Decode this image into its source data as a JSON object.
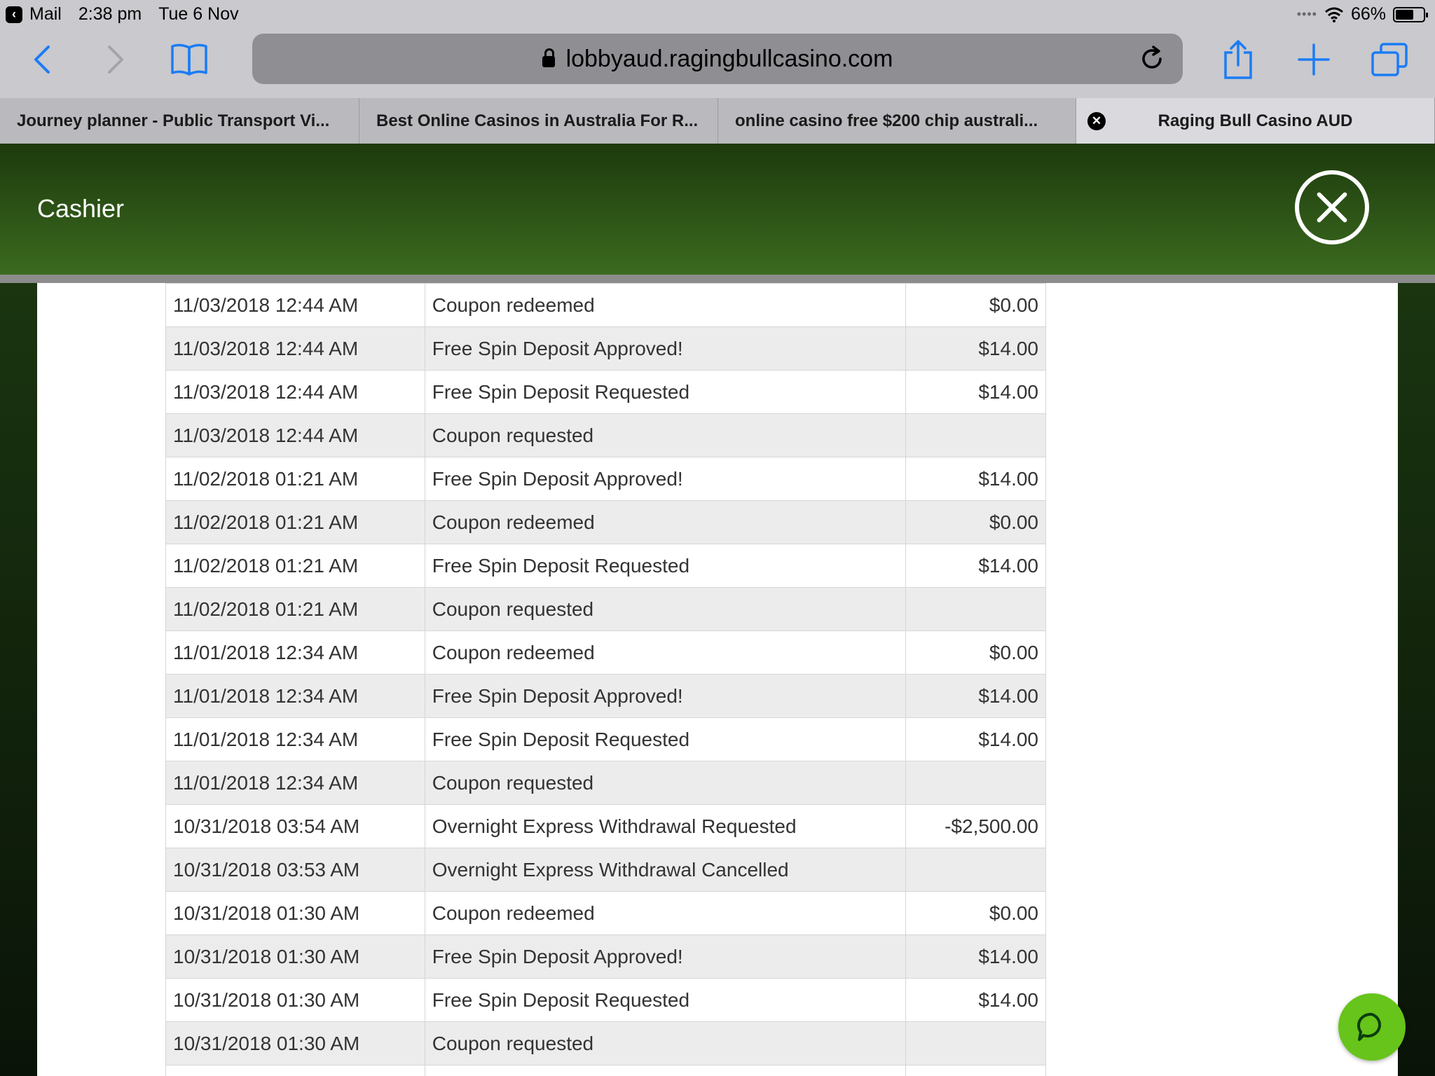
{
  "status_bar": {
    "back_app": "Mail",
    "time": "2:38 pm",
    "date": "Tue 6 Nov",
    "battery_percent": "66%",
    "battery_level": 0.66
  },
  "browser": {
    "url": "lobbyaud.ragingbullcasino.com",
    "tabs": [
      {
        "title": "Journey planner - Public Transport Vi..."
      },
      {
        "title": "Best Online Casinos in Australia For R..."
      },
      {
        "title": "online casino free $200 chip australi..."
      },
      {
        "title": "Raging Bull Casino AUD",
        "active": true
      }
    ]
  },
  "cashier": {
    "title": "Cashier"
  },
  "transactions": [
    {
      "date": "11/03/2018 12:44 AM",
      "description": "Coupon redeemed",
      "amount": "$0.00"
    },
    {
      "date": "11/03/2018 12:44 AM",
      "description": "Free Spin Deposit Approved!",
      "amount": "$14.00"
    },
    {
      "date": "11/03/2018 12:44 AM",
      "description": "Free Spin Deposit Requested",
      "amount": "$14.00"
    },
    {
      "date": "11/03/2018 12:44 AM",
      "description": "Coupon requested",
      "amount": ""
    },
    {
      "date": "11/02/2018 01:21 AM",
      "description": "Free Spin Deposit Approved!",
      "amount": "$14.00"
    },
    {
      "date": "11/02/2018 01:21 AM",
      "description": "Coupon redeemed",
      "amount": "$0.00"
    },
    {
      "date": "11/02/2018 01:21 AM",
      "description": "Free Spin Deposit Requested",
      "amount": "$14.00"
    },
    {
      "date": "11/02/2018 01:21 AM",
      "description": "Coupon requested",
      "amount": ""
    },
    {
      "date": "11/01/2018 12:34 AM",
      "description": "Coupon redeemed",
      "amount": "$0.00"
    },
    {
      "date": "11/01/2018 12:34 AM",
      "description": "Free Spin Deposit Approved!",
      "amount": "$14.00"
    },
    {
      "date": "11/01/2018 12:34 AM",
      "description": "Free Spin Deposit Requested",
      "amount": "$14.00"
    },
    {
      "date": "11/01/2018 12:34 AM",
      "description": "Coupon requested",
      "amount": ""
    },
    {
      "date": "10/31/2018 03:54 AM",
      "description": "Overnight Express Withdrawal Requested",
      "amount": "-$2,500.00"
    },
    {
      "date": "10/31/2018 03:53 AM",
      "description": "Overnight Express Withdrawal Cancelled",
      "amount": ""
    },
    {
      "date": "10/31/2018 01:30 AM",
      "description": "Coupon redeemed",
      "amount": "$0.00"
    },
    {
      "date": "10/31/2018 01:30 AM",
      "description": "Free Spin Deposit Approved!",
      "amount": "$14.00"
    },
    {
      "date": "10/31/2018 01:30 AM",
      "description": "Free Spin Deposit Requested",
      "amount": "$14.00"
    },
    {
      "date": "10/31/2018 01:30 AM",
      "description": "Coupon requested",
      "amount": ""
    },
    {
      "date": "",
      "description": "",
      "amount": ""
    }
  ],
  "colors": {
    "header_green": "#2d5416",
    "chat_green": "#66c41a",
    "safari_blue": "#1a7cf5"
  },
  "icons": {
    "back": "chevron-left-icon",
    "forward": "chevron-right-icon",
    "bookmarks": "book-icon",
    "share": "share-icon",
    "new_tab": "plus-icon",
    "tabs": "tabs-icon",
    "reload": "reload-icon",
    "close": "close-circle-icon",
    "chat": "chat-bubble-icon"
  }
}
